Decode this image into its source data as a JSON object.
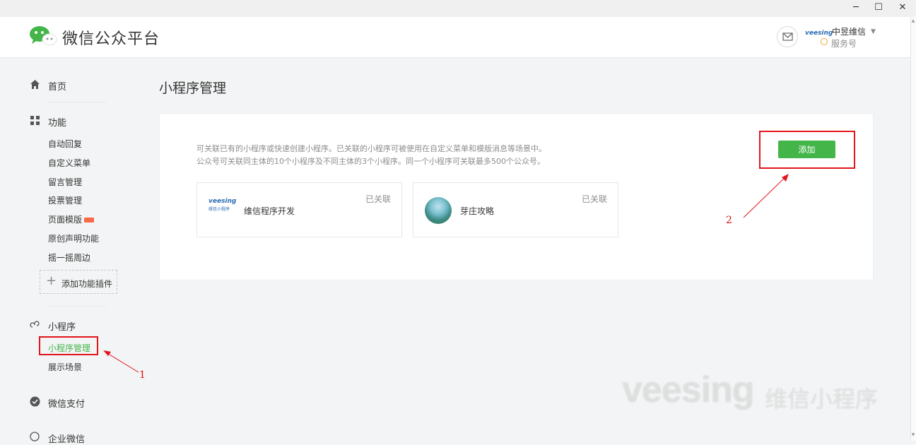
{
  "window": {
    "minimize": "─",
    "maximize": "☐",
    "close": "✕"
  },
  "header": {
    "brand": "微信公众平台",
    "account": {
      "logo_text": "veesing",
      "name": "中昱维信",
      "type": "服务号"
    }
  },
  "nav": {
    "home": "首页",
    "features": {
      "title": "功能",
      "items": [
        "自动回复",
        "自定义菜单",
        "留言管理",
        "投票管理",
        "页面模版",
        "原创声明功能",
        "摇一摇周边"
      ],
      "add_plugin": "添加功能插件"
    },
    "miniprogram": {
      "title": "小程序",
      "active_item": "小程序管理",
      "other_item": "展示场景"
    },
    "wechat_pay": "微信支付",
    "enterprise": "企业微信"
  },
  "main": {
    "title": "小程序管理",
    "desc_line1": "可关联已有的小程序或快速创建小程序。已关联的小程序可被使用在自定义菜单和模版消息等场景中。",
    "desc_line2": "公众号可关联同主体的10个小程序及不同主体的3个小程序。同一个小程序可关联最多500个公众号。",
    "add_button": "添加",
    "cards": [
      {
        "name": "维信程序开发",
        "status": "已关联",
        "thumb_text": "veesing",
        "thumb_sub": "维信小程序"
      },
      {
        "name": "芽庄攻略",
        "status": "已关联"
      }
    ]
  },
  "annotations": {
    "one": "1",
    "two": "2"
  },
  "watermark": {
    "latin": "veesing",
    "cjk": "维信小程序"
  },
  "colors": {
    "accent_green": "#44b549",
    "annotation_red": "#e2151b"
  }
}
